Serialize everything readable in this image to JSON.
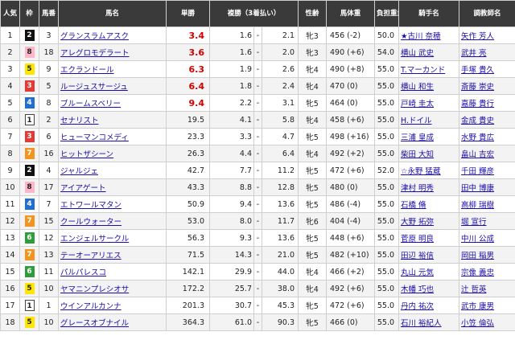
{
  "headers": {
    "popularity": "人気",
    "frame": "枠",
    "horse_number": "馬番",
    "horse_name": "馬名",
    "win_odds": "単勝",
    "place_odds": "複勝（3着払い）",
    "sex_age": "性齢",
    "body_weight": "馬体重",
    "burden_weight": "負担重量",
    "jockey": "騎手名",
    "trainer": "調教師名"
  },
  "colors": {
    "header_bg": "#3a3a3a",
    "odds_red": "#d40000",
    "link": "#1a0dab",
    "frame_1": "#ffffff",
    "frame_2": "#111111",
    "frame_3": "#e53935",
    "frame_4": "#1e6fd0",
    "frame_5": "#ffe600",
    "frame_6": "#2e9d3a",
    "frame_7": "#f2941e",
    "frame_8": "#ffb6c8"
  },
  "rows": [
    {
      "pop": "1",
      "waku": "2",
      "num": "3",
      "horse": "グランスラムアスク",
      "odds": "3.4",
      "odds_red": true,
      "plo": "1.6",
      "dash": "-",
      "phi": "2.1",
      "sex": "牝3",
      "weight": "456 (-2)",
      "kin": "50.0",
      "jockey": "★古川 奈穂",
      "trainer": "矢作 芳人"
    },
    {
      "pop": "2",
      "waku": "8",
      "num": "18",
      "horse": "アレグロモデラート",
      "odds": "3.6",
      "odds_red": true,
      "plo": "1.6",
      "dash": "-",
      "phi": "2.0",
      "sex": "牝3",
      "weight": "490 (+6)",
      "kin": "54.0",
      "jockey": "横山 武史",
      "trainer": "武井 亮"
    },
    {
      "pop": "3",
      "waku": "5",
      "num": "9",
      "horse": "エクランドール",
      "odds": "6.3",
      "odds_red": true,
      "plo": "1.9",
      "dash": "-",
      "phi": "2.6",
      "sex": "牝4",
      "weight": "490 (+8)",
      "kin": "55.0",
      "jockey": "T.マーカンド",
      "trainer": "手塚 貴久"
    },
    {
      "pop": "4",
      "waku": "3",
      "num": "5",
      "horse": "ルージュスサージュ",
      "odds": "6.4",
      "odds_red": true,
      "plo": "1.8",
      "dash": "-",
      "phi": "2.4",
      "sex": "牝4",
      "weight": "470 (0)",
      "kin": "55.0",
      "jockey": "横山 和生",
      "trainer": "斎藤 崇史"
    },
    {
      "pop": "5",
      "waku": "4",
      "num": "8",
      "horse": "ブルームスベリー",
      "odds": "9.4",
      "odds_red": true,
      "plo": "2.2",
      "dash": "-",
      "phi": "3.1",
      "sex": "牝5",
      "weight": "464 (0)",
      "kin": "55.0",
      "jockey": "戸崎 圭太",
      "trainer": "嘉藤 貴行"
    },
    {
      "pop": "6",
      "waku": "1",
      "num": "2",
      "horse": "セナリスト",
      "odds": "19.5",
      "odds_red": false,
      "plo": "4.1",
      "dash": "-",
      "phi": "5.8",
      "sex": "牝4",
      "weight": "458 (+6)",
      "kin": "55.0",
      "jockey": "H.ドイル",
      "trainer": "金成 貴史"
    },
    {
      "pop": "7",
      "waku": "3",
      "num": "6",
      "horse": "ヒューマンコメディ",
      "odds": "23.3",
      "odds_red": false,
      "plo": "3.3",
      "dash": "-",
      "phi": "4.7",
      "sex": "牝5",
      "weight": "498 (+16)",
      "kin": "55.0",
      "jockey": "三浦 皇成",
      "trainer": "水野 貴広"
    },
    {
      "pop": "8",
      "waku": "7",
      "num": "16",
      "horse": "ヒットザシーン",
      "odds": "26.3",
      "odds_red": false,
      "plo": "4.4",
      "dash": "-",
      "phi": "6.4",
      "sex": "牝4",
      "weight": "492 (+2)",
      "kin": "55.0",
      "jockey": "柴田 大知",
      "trainer": "畠山 吉宏"
    },
    {
      "pop": "9",
      "waku": "2",
      "num": "4",
      "horse": "ジャルジェ",
      "odds": "42.7",
      "odds_red": false,
      "plo": "7.7",
      "dash": "-",
      "phi": "11.2",
      "sex": "牝5",
      "weight": "472 (+6)",
      "kin": "52.0",
      "jockey": "☆永野 猛蔵",
      "trainer": "千田 輝彦"
    },
    {
      "pop": "10",
      "waku": "8",
      "num": "17",
      "horse": "アイアゲート",
      "odds": "43.3",
      "odds_red": false,
      "plo": "8.8",
      "dash": "-",
      "phi": "12.8",
      "sex": "牝5",
      "weight": "480 (0)",
      "kin": "55.0",
      "jockey": "津村 明秀",
      "trainer": "田中 博康"
    },
    {
      "pop": "11",
      "waku": "4",
      "num": "7",
      "horse": "エトワールマタン",
      "odds": "50.9",
      "odds_red": false,
      "plo": "9.4",
      "dash": "-",
      "phi": "13.6",
      "sex": "牝5",
      "weight": "486 (-4)",
      "kin": "55.0",
      "jockey": "石橋 脩",
      "trainer": "高柳 瑞樹"
    },
    {
      "pop": "12",
      "waku": "7",
      "num": "15",
      "horse": "クールウォーター",
      "odds": "53.0",
      "odds_red": false,
      "plo": "8.0",
      "dash": "-",
      "phi": "11.7",
      "sex": "牝6",
      "weight": "404 (-4)",
      "kin": "55.0",
      "jockey": "大野 拓弥",
      "trainer": "堀 宣行"
    },
    {
      "pop": "13",
      "waku": "6",
      "num": "12",
      "horse": "エンジェルサークル",
      "odds": "56.3",
      "odds_red": false,
      "plo": "9.3",
      "dash": "-",
      "phi": "13.6",
      "sex": "牝5",
      "weight": "448 (+6)",
      "kin": "55.0",
      "jockey": "菅原 明良",
      "trainer": "中川 公成"
    },
    {
      "pop": "14",
      "waku": "7",
      "num": "13",
      "horse": "テーオーアリエス",
      "odds": "71.5",
      "odds_red": false,
      "plo": "14.3",
      "dash": "-",
      "phi": "21.0",
      "sex": "牝5",
      "weight": "482 (+10)",
      "kin": "55.0",
      "jockey": "田辺 裕信",
      "trainer": "岡田 稲男"
    },
    {
      "pop": "15",
      "waku": "6",
      "num": "11",
      "horse": "パルパレスコ",
      "odds": "142.1",
      "odds_red": false,
      "plo": "29.9",
      "dash": "-",
      "phi": "44.0",
      "sex": "牝4",
      "weight": "466 (+2)",
      "kin": "55.0",
      "jockey": "丸山 元気",
      "trainer": "宗像 義忠"
    },
    {
      "pop": "16",
      "waku": "5",
      "num": "10",
      "horse": "ヤマニンプレシオサ",
      "odds": "172.2",
      "odds_red": false,
      "plo": "25.7",
      "dash": "-",
      "phi": "38.0",
      "sex": "牝4",
      "weight": "492 (+6)",
      "kin": "55.0",
      "jockey": "木幡 巧也",
      "trainer": "辻 哲英"
    },
    {
      "pop": "17",
      "waku": "1",
      "num": "1",
      "horse": "ウインアルカンナ",
      "odds": "201.3",
      "odds_red": false,
      "plo": "30.7",
      "dash": "-",
      "phi": "45.3",
      "sex": "牝5",
      "weight": "472 (+6)",
      "kin": "55.0",
      "jockey": "丹内 祐次",
      "trainer": "武市 康男"
    },
    {
      "pop": "18",
      "waku": "5",
      "num": "10",
      "horse": "グレースオブナイル",
      "odds": "364.3",
      "odds_red": false,
      "plo": "61.0",
      "dash": "-",
      "phi": "90.3",
      "sex": "牝5",
      "weight": "466 (0)",
      "kin": "55.0",
      "jockey": "石川 裕紀人",
      "trainer": "小笠 倫弘"
    }
  ]
}
